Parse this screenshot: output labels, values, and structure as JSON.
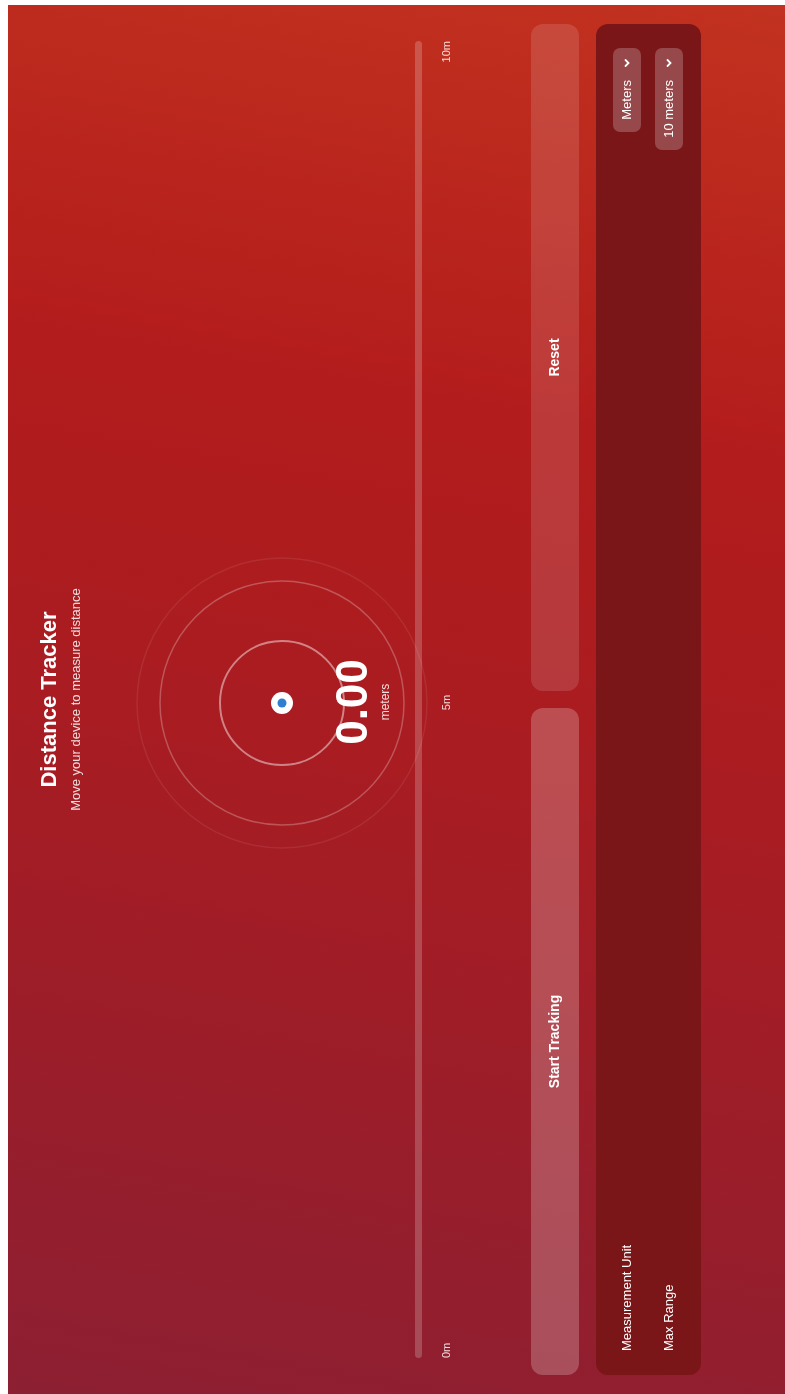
{
  "header": {
    "title": "Distance Tracker",
    "subtitle": "Move your device to measure distance"
  },
  "reading": {
    "value": "0.00",
    "unit": "meters"
  },
  "scale": {
    "labels": [
      "0m",
      "5m",
      "10m"
    ]
  },
  "buttons": [
    {
      "label": "Start Tracking",
      "kind": "primary"
    },
    {
      "label": "Reset",
      "kind": "secondary"
    }
  ],
  "settings": [
    {
      "label": "Measurement Unit",
      "value": "Meters"
    },
    {
      "label": "Max Range",
      "value": "10 meters"
    }
  ]
}
